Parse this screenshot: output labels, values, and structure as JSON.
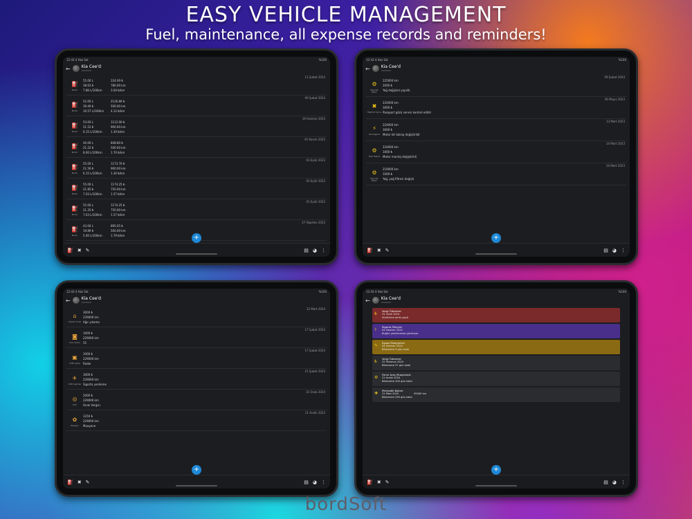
{
  "header": {
    "title": "EASY VEHICLE MANAGEMENT",
    "subtitle": "Fuel, maintenance, all expense records and reminders!"
  },
  "brand": {
    "logo": "bordSoft"
  },
  "car": {
    "name": "Kia Cee'd",
    "plate": "XXXXXXX"
  },
  "status": {
    "left": "12:43  4 Haz Sal",
    "right": "%100"
  },
  "colors": {
    "fab": "#1e88d6",
    "fuel_icon": "#e02424",
    "reminder_red": "#7a2a2a",
    "reminder_purple": "#4a2f8a",
    "reminder_gold": "#8a6a12",
    "reminder_gray": "#2a2c30"
  },
  "fuel": [
    {
      "date": "11 Şubat 2024",
      "a": "55.00 L",
      "b": "38.63 ₺",
      "c": "7.86 L/100km",
      "d": "224.00 ₺",
      "e": "780.00 km",
      "f": "3.04 ₺/km"
    },
    {
      "date": "09 Şubat 2024",
      "a": "52.00 L",
      "b": "39.40 ₺",
      "c": "10.57 L/100km",
      "d": "2126.80 ₺",
      "e": "500.00 km",
      "f": "4.12 ₺/km"
    },
    {
      "date": "16 Haziran 2023",
      "a": "53.00 L",
      "b": "21.52 ₺",
      "c": "6.15 L/100km",
      "d": "1112.00 ₺",
      "e": "900.00 km",
      "f": "1.30 ₺/km"
    },
    {
      "date": "01 Kasım 2022",
      "a": "40.00 L",
      "b": "21.22 ₺",
      "c": "8.00 L/100km",
      "d": "848.80 ₺",
      "e": "500.00 km",
      "f": "1.70 ₺/km"
    },
    {
      "date": "03 Eylül 2022",
      "a": "55.00 L",
      "b": "21.56 ₺",
      "c": "6.15 L/100km",
      "d": "1173.70 ₺",
      "e": "900.00 km",
      "f": "1.30 ₺/km"
    },
    {
      "date": "02 Eylül 2022",
      "a": "55.00 L",
      "b": "21.85 ₺",
      "c": "7.03 L/100km",
      "d": "1174.25 ₺",
      "e": "750.00 km",
      "f": "1.57 ₺/km"
    },
    {
      "date": "01 Eylül 2022",
      "a": "55.00 L",
      "b": "21.35 ₺",
      "c": "7.03 L/100km",
      "d": "1174.25 ₺",
      "e": "750.00 km",
      "f": "1.57 ₺/km"
    },
    {
      "date": "27 Ağustos 2022",
      "a": "43.00 L",
      "b": "19.89 ₺",
      "c": "5.00 L/100km",
      "d": "895.05 ₺",
      "e": "500.00 km",
      "f": "1.79 ₺/km"
    }
  ],
  "fuel_label": "Benzin",
  "maintenance": [
    {
      "date": "09 Şubat 2024",
      "label": "Periyodik Bakım",
      "km": "225000 km",
      "cost": "2000 ₺",
      "note": "Yağ değişimi yapıldı"
    },
    {
      "date": "26 Mayıs 2023",
      "label": "Bağımsız Servis",
      "km": "224000 km",
      "cost": "3000 ₺",
      "note": "Pasaport gözü servisi kontrol edildi"
    },
    {
      "date": "13 Mart 2023",
      "label": "Akü Değişimi",
      "km": "224000 km",
      "cost": "3000 ₺",
      "note": "Motor kit takılıp değiştirildi"
    },
    {
      "date": "24 Mart 2023",
      "label": "Motor Bakımı",
      "km": "224000 km",
      "cost": "1000 ₺",
      "note": "Motor montaj değiştirildi"
    },
    {
      "date": "03 Mart 2023",
      "label": "Periyodik Bakım",
      "km": "219000 km",
      "cost": "1000 ₺",
      "note": "Yağ, yağ filtresi değişti"
    }
  ],
  "expenses": [
    {
      "date": "22 Mart 2024",
      "label": "Otopark Ücreti",
      "cost": "3000 ₺",
      "km": "229000 km",
      "note": "Ağır yıkama"
    },
    {
      "date": "17 Şubat 2024",
      "label": "Araç Yıkama",
      "cost": "1000 ₺",
      "km": "229000 km",
      "note": "55"
    },
    {
      "date": "17 Şubat 2024",
      "label": "Trafik Cezası",
      "cost": "1000 ₺",
      "km": "229000 km",
      "note": "Radar"
    },
    {
      "date": "15 Şubat 2024",
      "label": "Trafik Sigortası",
      "cost": "3000 ₺",
      "km": "229000 km",
      "note": "Sigorta yenileme"
    },
    {
      "date": "31 Ocak 2024",
      "label": "MTV",
      "cost": "2000 ₺",
      "km": "229000 km",
      "note": "Ocak Vergisi"
    },
    {
      "date": "21 Aralık 2023",
      "label": "Muayene",
      "cost": "1250 ₺",
      "km": "229000 km",
      "note": "Muayene"
    }
  ],
  "reminders": [
    {
      "title": "Vergi Ödemesi",
      "date": "31 Ocak 2024",
      "status": "Sürdürme tarihi geçti"
    },
    {
      "title": "Sigorta Poliçesi",
      "date": "04 Haziran 2024",
      "status": "Bugün yenilenmesi gerekiyor"
    },
    {
      "title": "Egzoz Muayenesi",
      "date": "04 Haziran 2024",
      "status": "Bitmesine 0 gün kaldı"
    },
    {
      "title": "Vergi Ödemesi",
      "date": "31 Temmuz 2024",
      "status": "Bitmesine 57 gün kaldı"
    },
    {
      "title": "Fenni Araç Muayenesi",
      "date": "21 Aralık 2024",
      "status": "Bitmesine 200 gün kaldı"
    },
    {
      "title": "Periyodik Bakım",
      "date": "21 Mart 2025",
      "status": "Bitmesine 290 gün kaldı",
      "km": "95000 km"
    }
  ],
  "fab_label": "+"
}
